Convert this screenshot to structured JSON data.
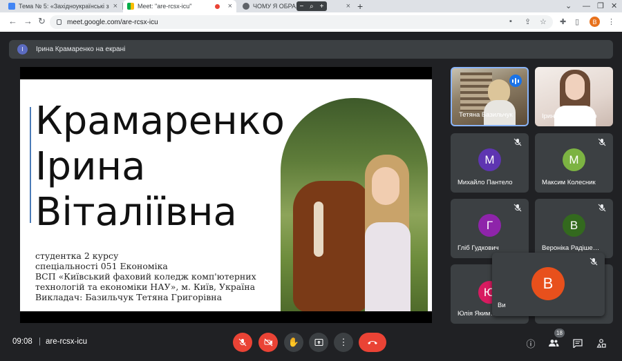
{
  "browser": {
    "tabs": [
      {
        "title": "Тема № 5: «Західноукраїнські з",
        "favicon_color": "#4285f4"
      },
      {
        "title": "Meet: \"are-rcsx-icu\"",
        "favicon_color": "#00ac47"
      },
      {
        "title": "ЧОМУ Я ОБРАЛ… КУ?",
        "favicon_color": "#5f6368"
      }
    ],
    "zoom_minus": "−",
    "zoom_plus": "+",
    "url": "meet.google.com/are-rcsx-icu",
    "profile_initial": "B",
    "profile_color": "#e8711c"
  },
  "meet": {
    "presenting_banner": "Ірина Крамаренко на екрані",
    "presenter_initial": "І",
    "slide": {
      "name_lines": [
        "Крамаренко",
        "Ірина",
        "Віталіївна"
      ],
      "info_lines": [
        "студентка 2 курсу",
        "спеціальності 051 Економіка",
        "ВСП «Київський фаховий коледж комп'ютерних",
        "технологій та економіки НАУ», м. Київ, Україна",
        "Викладач: Базильчук Тетяна Григорівна"
      ]
    },
    "participants": [
      {
        "name": "Тетяна Базильчук",
        "type": "video",
        "speaking": true
      },
      {
        "name": "Ірина Крамаренко",
        "type": "video"
      },
      {
        "name": "Михайло Пантело",
        "initial": "М",
        "color": "#5e35b1",
        "muted": true
      },
      {
        "name": "Максим Колесник",
        "initial": "М",
        "color": "#7cb342",
        "muted": true
      },
      {
        "name": "Гліб Гудкович",
        "initial": "Г",
        "color": "#8e24aa",
        "muted": true
      },
      {
        "name": "Вероніка Радіше…",
        "initial": "В",
        "color": "#33691e",
        "muted": true
      },
      {
        "name": "Юлія Яким…",
        "initial": "Ю",
        "color": "#d81b60",
        "muted": false
      },
      {
        "name": "Ви",
        "initial": "В",
        "color": "#e8501c",
        "muted": true
      }
    ],
    "footer": {
      "time": "09:08",
      "separator": "|",
      "meeting_code": "are-rcsx-icu",
      "people_count": "18"
    }
  }
}
